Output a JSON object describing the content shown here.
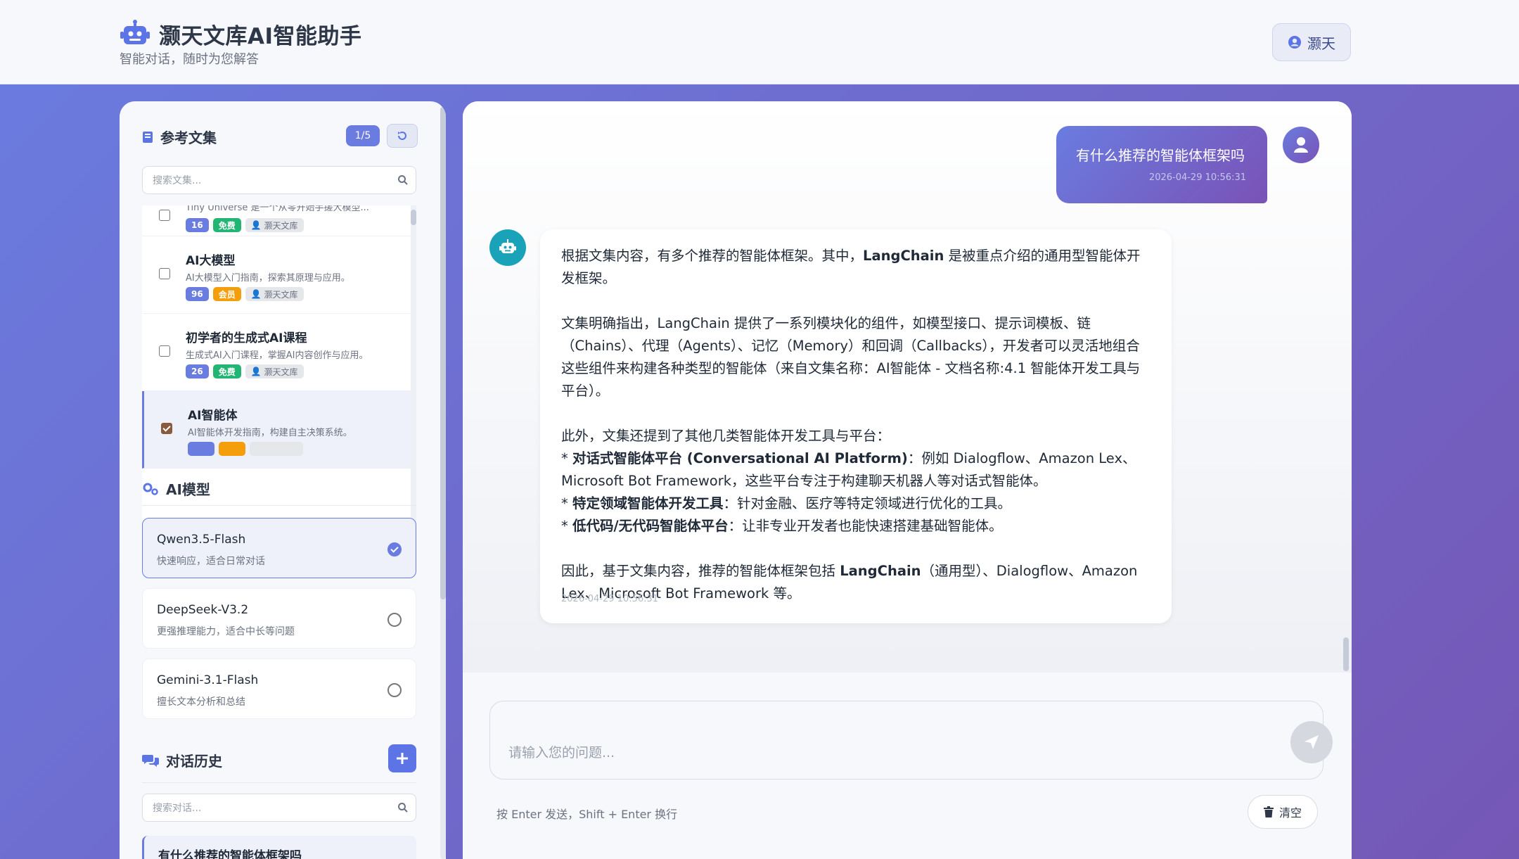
{
  "header": {
    "title": "灏天文库AI智能助手",
    "subtitle": "智能对话，随时为您解答",
    "user_name": "灏天"
  },
  "docs": {
    "title": "参考文集",
    "count_badge": "1/5",
    "search_placeholder": "搜索文集...",
    "partial_top_desc": "Tiny Universe 是一个从零开始手搓大模型...",
    "partial_top_tags": [
      "16",
      "免费",
      "灏天文库"
    ],
    "items": [
      {
        "title": "AI大模型",
        "desc": "AI大模型入门指南，探索其原理与应用。",
        "count": "96",
        "type": "会员",
        "author": "灏天文库",
        "checked": false
      },
      {
        "title": "初学者的生成式AI课程",
        "desc": "生成式AI入门课程，掌握AI内容创作与应用。",
        "count": "26",
        "type": "免费",
        "author": "灏天文库",
        "checked": false
      },
      {
        "title": "AI智能体",
        "desc": "AI智能体开发指南，构建自主决策系统。",
        "count": "",
        "type": "",
        "author": "",
        "checked": true
      }
    ]
  },
  "models": {
    "title": "AI模型",
    "items": [
      {
        "name": "Qwen3.5-Flash",
        "desc": "快速响应，适合日常对话",
        "selected": true
      },
      {
        "name": "DeepSeek-V3.2",
        "desc": "更强推理能力，适合中长等问题",
        "selected": false
      },
      {
        "name": "Gemini-3.1-Flash",
        "desc": "擅长文本分析和总结",
        "selected": false
      }
    ]
  },
  "history": {
    "title": "对话历史",
    "search_placeholder": "搜索对话...",
    "items": [
      {
        "title": "有什么推荐的智能体框架吗"
      }
    ]
  },
  "chat": {
    "user_message": "有什么推荐的智能体框架吗",
    "user_time": "2026-04-29 10:56:31",
    "bot_time": "2026-04-29 10:56:31",
    "bot_p1_pre": "根据文集内容，有多个推荐的智能体框架。其中，",
    "bot_p1_bold": "LangChain",
    "bot_p1_post": " 是被重点介绍的通用型智能体开发框架。",
    "bot_p2": "文集明确指出，LangChain 提供了一系列模块化的组件，如模型接口、提示词模板、链（Chains）、代理（Agents）、记忆（Memory）和回调（Callbacks），开发者可以灵活地组合这些组件来构建各种类型的智能体（来自文集名称：AI智能体 - 文档名称:4.1 智能体开发工具与平台）。",
    "bot_p3": "此外，文集还提到了其他几类智能体开发工具与平台：",
    "bullet1_bold": "对话式智能体平台 (Conversational AI Platform)",
    "bullet1_text": "：例如 Dialogflow、Amazon Lex、Microsoft Bot Framework，这些平台专注于构建聊天机器人等对话式智能体。",
    "bullet2_bold": "特定领域智能体开发工具",
    "bullet2_text": "：针对金融、医疗等特定领域进行优化的工具。",
    "bullet3_bold": "低代码/无代码智能体平台",
    "bullet3_text": "：让非专业开发者也能快速搭建基础智能体。",
    "bot_p4_pre": "因此，基于文集内容，推荐的智能体框架包括 ",
    "bot_p4_bold": "LangChain",
    "bot_p4_post": "（通用型）、Dialogflow、Amazon Lex、Microsoft Bot Framework 等。",
    "input_placeholder": "请输入您的问题...",
    "hint": "按 Enter 发送，Shift + Enter 换行",
    "clear_label": "清空"
  }
}
